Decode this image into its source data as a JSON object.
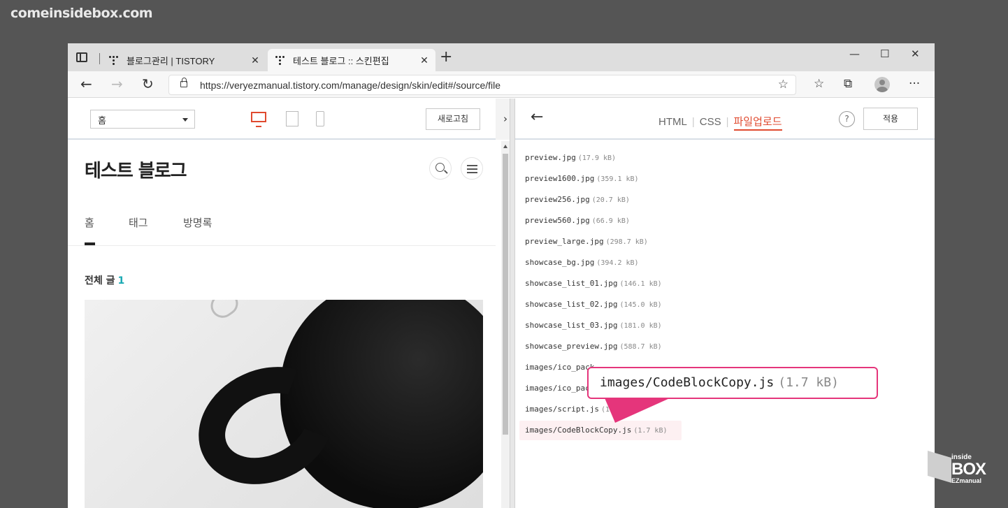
{
  "watermark": "comeinsidebox.com",
  "browser": {
    "tabs": [
      {
        "title": "블로그관리 | TISTORY",
        "close": "✕"
      },
      {
        "title": "테스트 블로그 :: 스킨편집",
        "close": "✕"
      }
    ],
    "new_tab": "+",
    "window": {
      "minimize": "—",
      "maximize": "☐",
      "close": "✕"
    },
    "url": "https://veryezmanual.tistory.com/manage/design/skin/edit#/source/file",
    "nav": {
      "back": "←",
      "forward": "→",
      "refresh": "↻"
    },
    "toolbar_icons": [
      "favorites-add-icon",
      "favorites-icon",
      "collections-icon",
      "profile-icon",
      "more-icon"
    ],
    "more": "···"
  },
  "left_panel": {
    "page_select": "홈",
    "refresh_button": "새로고침",
    "collapse": "›",
    "device_modes": [
      "desktop",
      "tablet",
      "mobile"
    ],
    "active_device": "desktop",
    "accent_color": "#e04a2f"
  },
  "blog_preview": {
    "title": "테스트 블로그",
    "nav": [
      "홈",
      "태그",
      "방명록"
    ],
    "active_nav": "홈",
    "posts_label": "전체 글",
    "posts_count": "1"
  },
  "editor": {
    "back": "←",
    "tabs": [
      "HTML",
      "CSS",
      "파일업로드"
    ],
    "active_tab": "파일업로드",
    "help": "?",
    "apply_button": "적용",
    "files": [
      {
        "name": "preview.jpg",
        "size": "(17.9 kB)"
      },
      {
        "name": "preview1600.jpg",
        "size": "(359.1 kB)"
      },
      {
        "name": "preview256.jpg",
        "size": "(20.7 kB)"
      },
      {
        "name": "preview560.jpg",
        "size": "(66.9 kB)"
      },
      {
        "name": "preview_large.jpg",
        "size": "(298.7 kB)"
      },
      {
        "name": "showcase_bg.jpg",
        "size": "(394.2 kB)"
      },
      {
        "name": "showcase_list_01.jpg",
        "size": "(146.1 kB)"
      },
      {
        "name": "showcase_list_02.jpg",
        "size": "(145.0 kB)"
      },
      {
        "name": "showcase_list_03.jpg",
        "size": "(181.0 kB)"
      },
      {
        "name": "showcase_preview.jpg",
        "size": "(588.7 kB)"
      },
      {
        "name": "images/ico_pack",
        "size": ""
      },
      {
        "name": "images/ico_pack",
        "size": ""
      },
      {
        "name": "images/script.js",
        "size": "(11"
      },
      {
        "name": "images/CodeBlockCopy.js",
        "size": "(1.7 kB)"
      }
    ],
    "highlighted_index": 13
  },
  "callout": {
    "name": "images/CodeBlockCopy.js",
    "size": "(1.7 kB)",
    "color": "#e5357b"
  },
  "logo": {
    "line1": "inside",
    "line2": "BOX",
    "line3": "EZmanual"
  }
}
